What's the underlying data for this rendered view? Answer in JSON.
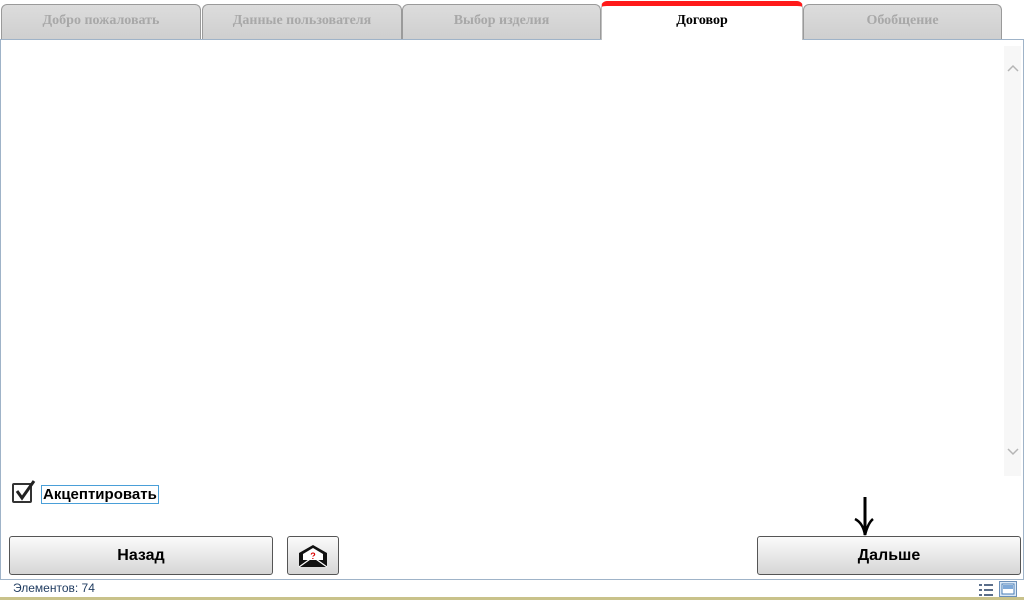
{
  "tabs": [
    {
      "label": "Добро пожаловать",
      "active": false
    },
    {
      "label": "Данные пользователя",
      "active": false
    },
    {
      "label": "Выбор изделия",
      "active": false
    },
    {
      "label": "Договор",
      "active": true
    },
    {
      "label": "Обобщение",
      "active": false
    }
  ],
  "accept": {
    "label": "Акцептировать",
    "checked": true
  },
  "buttons": {
    "back": "Назад",
    "mail_icon": "help-mail-icon",
    "next": "Дальше"
  },
  "status": {
    "items_text": "Элементов: 74"
  },
  "colors": {
    "active_tab_accent": "#ff1a1a",
    "border": "#9fb3c8"
  }
}
